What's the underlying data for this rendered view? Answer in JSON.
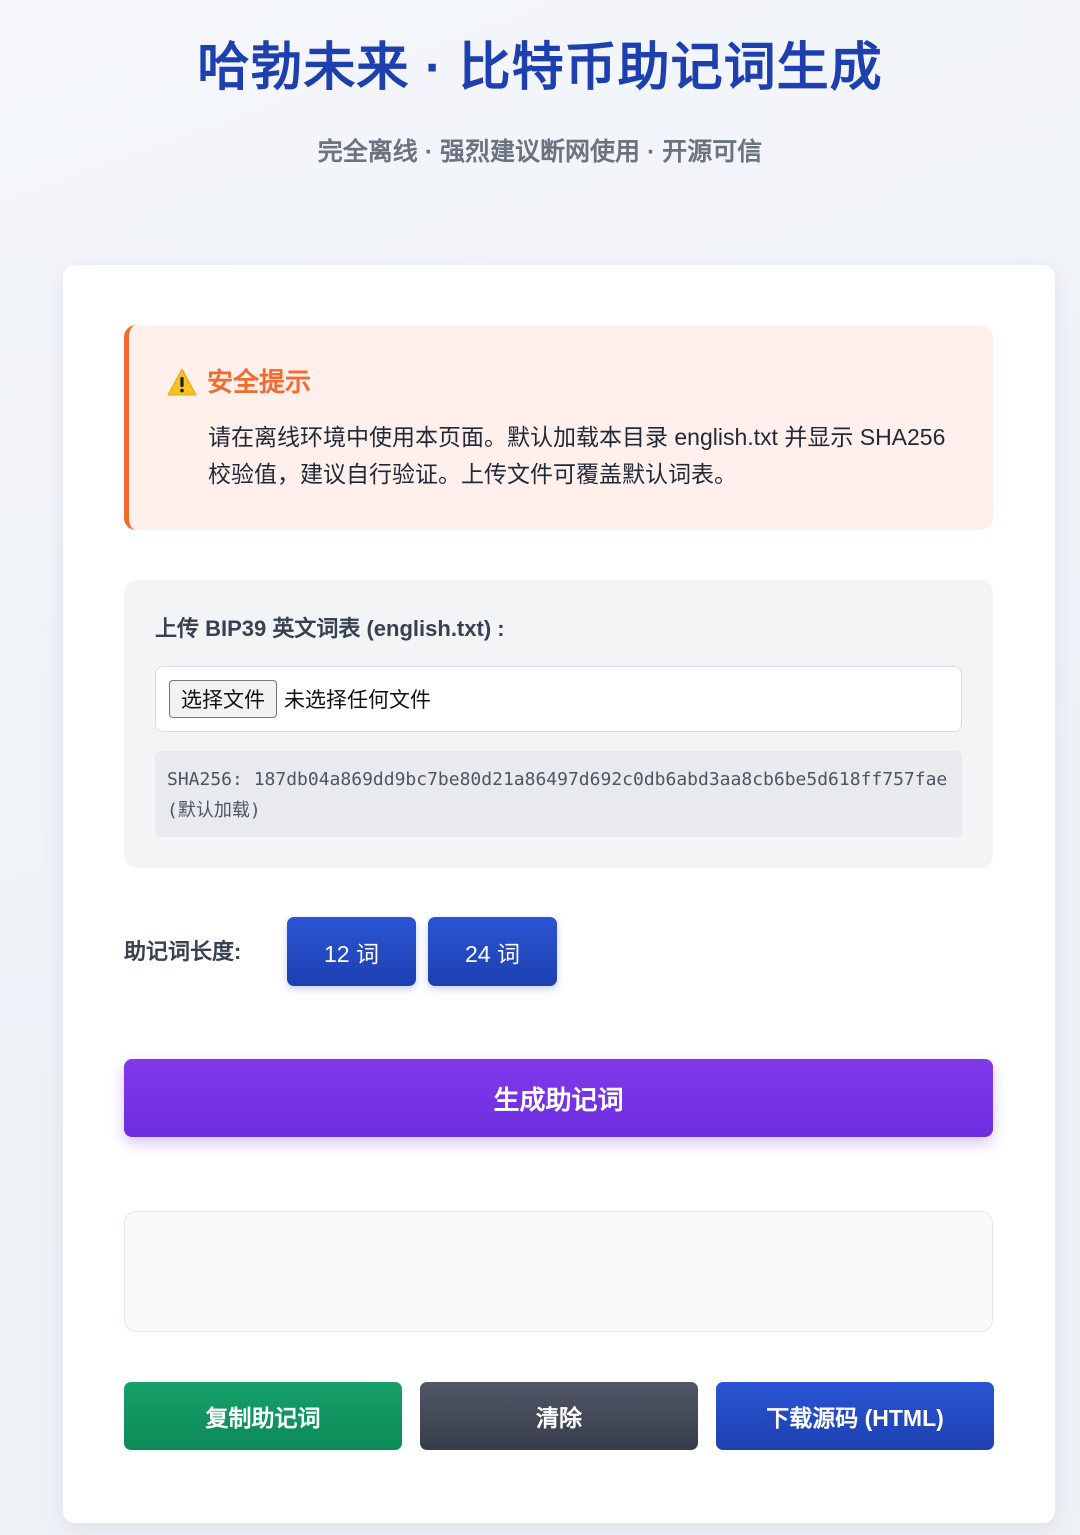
{
  "header": {
    "title": "哈勃未来 · 比特币助记词生成",
    "subtitle": "完全离线 · 强烈建议断网使用 · 开源可信"
  },
  "warning": {
    "icon": "warning-icon",
    "title": "安全提示",
    "text": "请在离线环境中使用本页面。默认加载本目录 english.txt 并显示 SHA256 校验值，建议自行验证。上传文件可覆盖默认词表。",
    "accent_color": "#f26a2e"
  },
  "upload": {
    "label": "上传 BIP39 英文词表 (english.txt) :",
    "file_button": "选择文件",
    "file_status": "未选择任何文件",
    "sha": "SHA256: 187db04a869dd9bc7be80d21a86497d692c0db6abd3aa8cb6be5d618ff757fae (默认加载)"
  },
  "length": {
    "label": "助记词长度:",
    "options": [
      "12 词",
      "24 词"
    ]
  },
  "generate_button": "生成助记词",
  "output": {
    "value": ""
  },
  "actions": {
    "copy": "复制助记词",
    "clear": "清除",
    "download": "下载源码 (HTML)"
  },
  "colors": {
    "title": "#1e40af",
    "generate": "#7433e6",
    "copy": "#0f9462",
    "clear": "#424957",
    "download": "#234acc"
  }
}
